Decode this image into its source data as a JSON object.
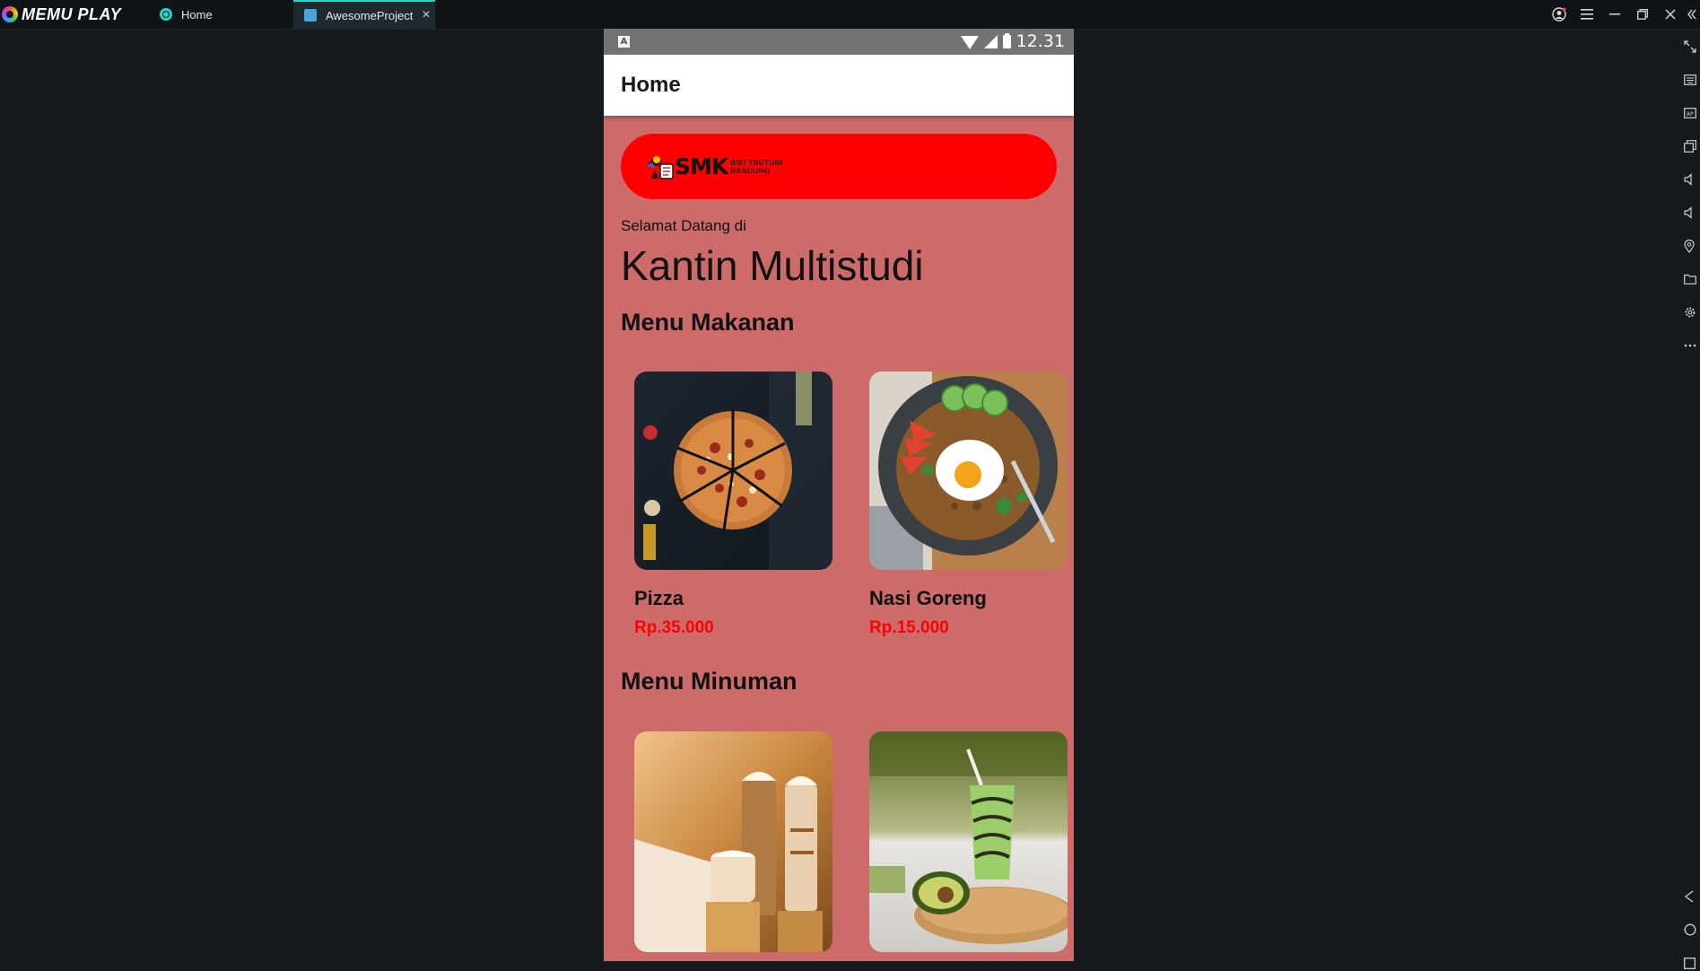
{
  "emulator": {
    "brand": "MEMU PLAY",
    "tabs": [
      {
        "label": "Home"
      },
      {
        "label": "AwesomeProject"
      }
    ],
    "tab_close": "×",
    "window_controls": [
      "user-icon",
      "menu-icon",
      "minimize-icon",
      "restore-icon",
      "close-icon"
    ],
    "tools": [
      "fullscreen-icon",
      "keyboard-icon",
      "apk-icon",
      "multi-window-icon",
      "volume-up-icon",
      "volume-down-icon",
      "location-icon",
      "folder-icon",
      "settings-icon",
      "more-icon",
      "back-icon",
      "home-icon",
      "recents-icon"
    ]
  },
  "statusbar": {
    "notification_badge": "A",
    "time": "12.31"
  },
  "appbar": {
    "title": "Home"
  },
  "banner": {
    "logo_text": "SMK",
    "logo_subtitle_1": "BIEI TSUTUNI",
    "logo_subtitle_2": "BANDUNG"
  },
  "greeting": "Selamat Datang di",
  "headline": "Kantin Multistudi",
  "food_section": {
    "title": "Menu Makanan",
    "items": [
      {
        "name": "Pizza",
        "price": "Rp.35.000"
      },
      {
        "name": "Nasi Goreng",
        "price": "Rp.15.000"
      }
    ]
  },
  "drink_section": {
    "title": "Menu Minuman",
    "items": [
      {
        "name": "",
        "price": ""
      },
      {
        "name": "",
        "price": ""
      }
    ]
  },
  "colors": {
    "page_background": "#cd6b6b",
    "banner": "#ff0000",
    "price": "#ff0000",
    "emulator_accent": "#2bd3c6"
  }
}
